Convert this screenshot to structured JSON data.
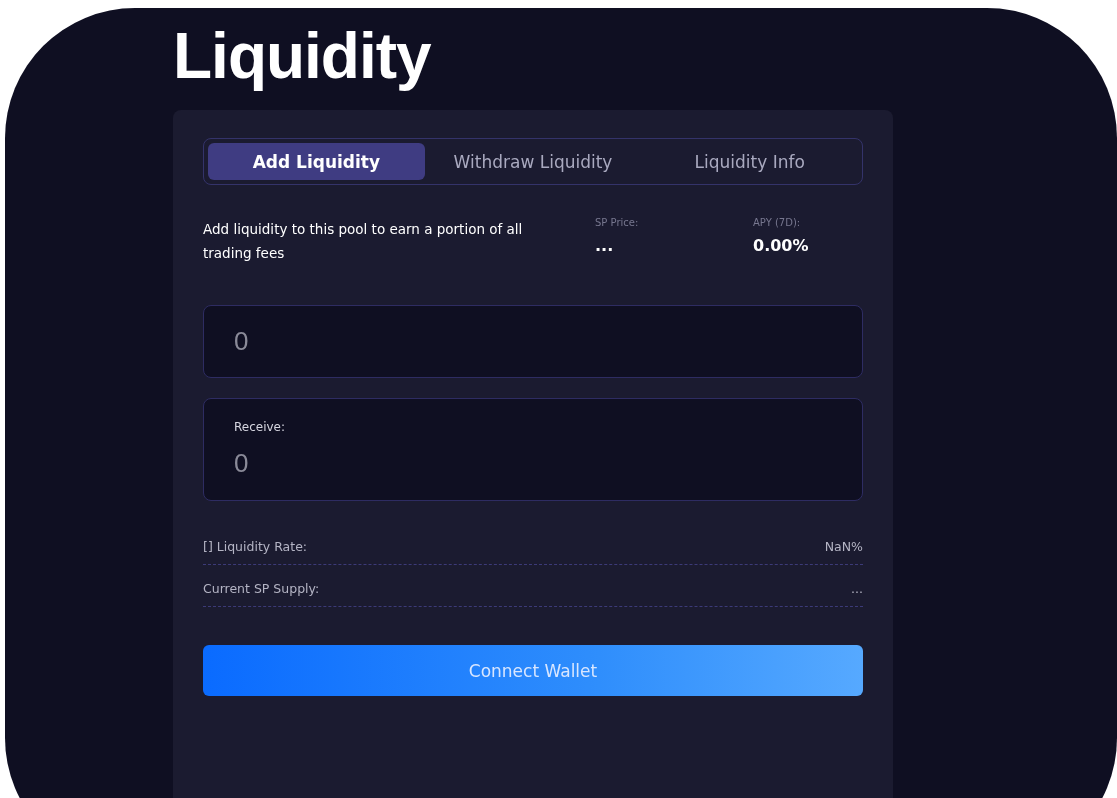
{
  "title": "Liquidity",
  "tabs": [
    {
      "label": "Add Liquidity",
      "selected": true
    },
    {
      "label": "Withdraw Liquidity",
      "selected": false
    },
    {
      "label": "Liquidity Info",
      "selected": false
    }
  ],
  "description": "Add liquidity to this pool to earn a portion of all trading fees",
  "stats": [
    {
      "label": "SP Price:",
      "value": "..."
    },
    {
      "label": "APY (7D):",
      "value": "0.00%"
    }
  ],
  "amount_field": {
    "placeholder": "0"
  },
  "receive_field": {
    "label": "Receive:",
    "placeholder": "0"
  },
  "details": [
    {
      "label": "[] Liquidity Rate:",
      "value": "NaN%"
    },
    {
      "label": "Current SP Supply:",
      "value": "..."
    }
  ],
  "connect_button": "Connect Wallet"
}
